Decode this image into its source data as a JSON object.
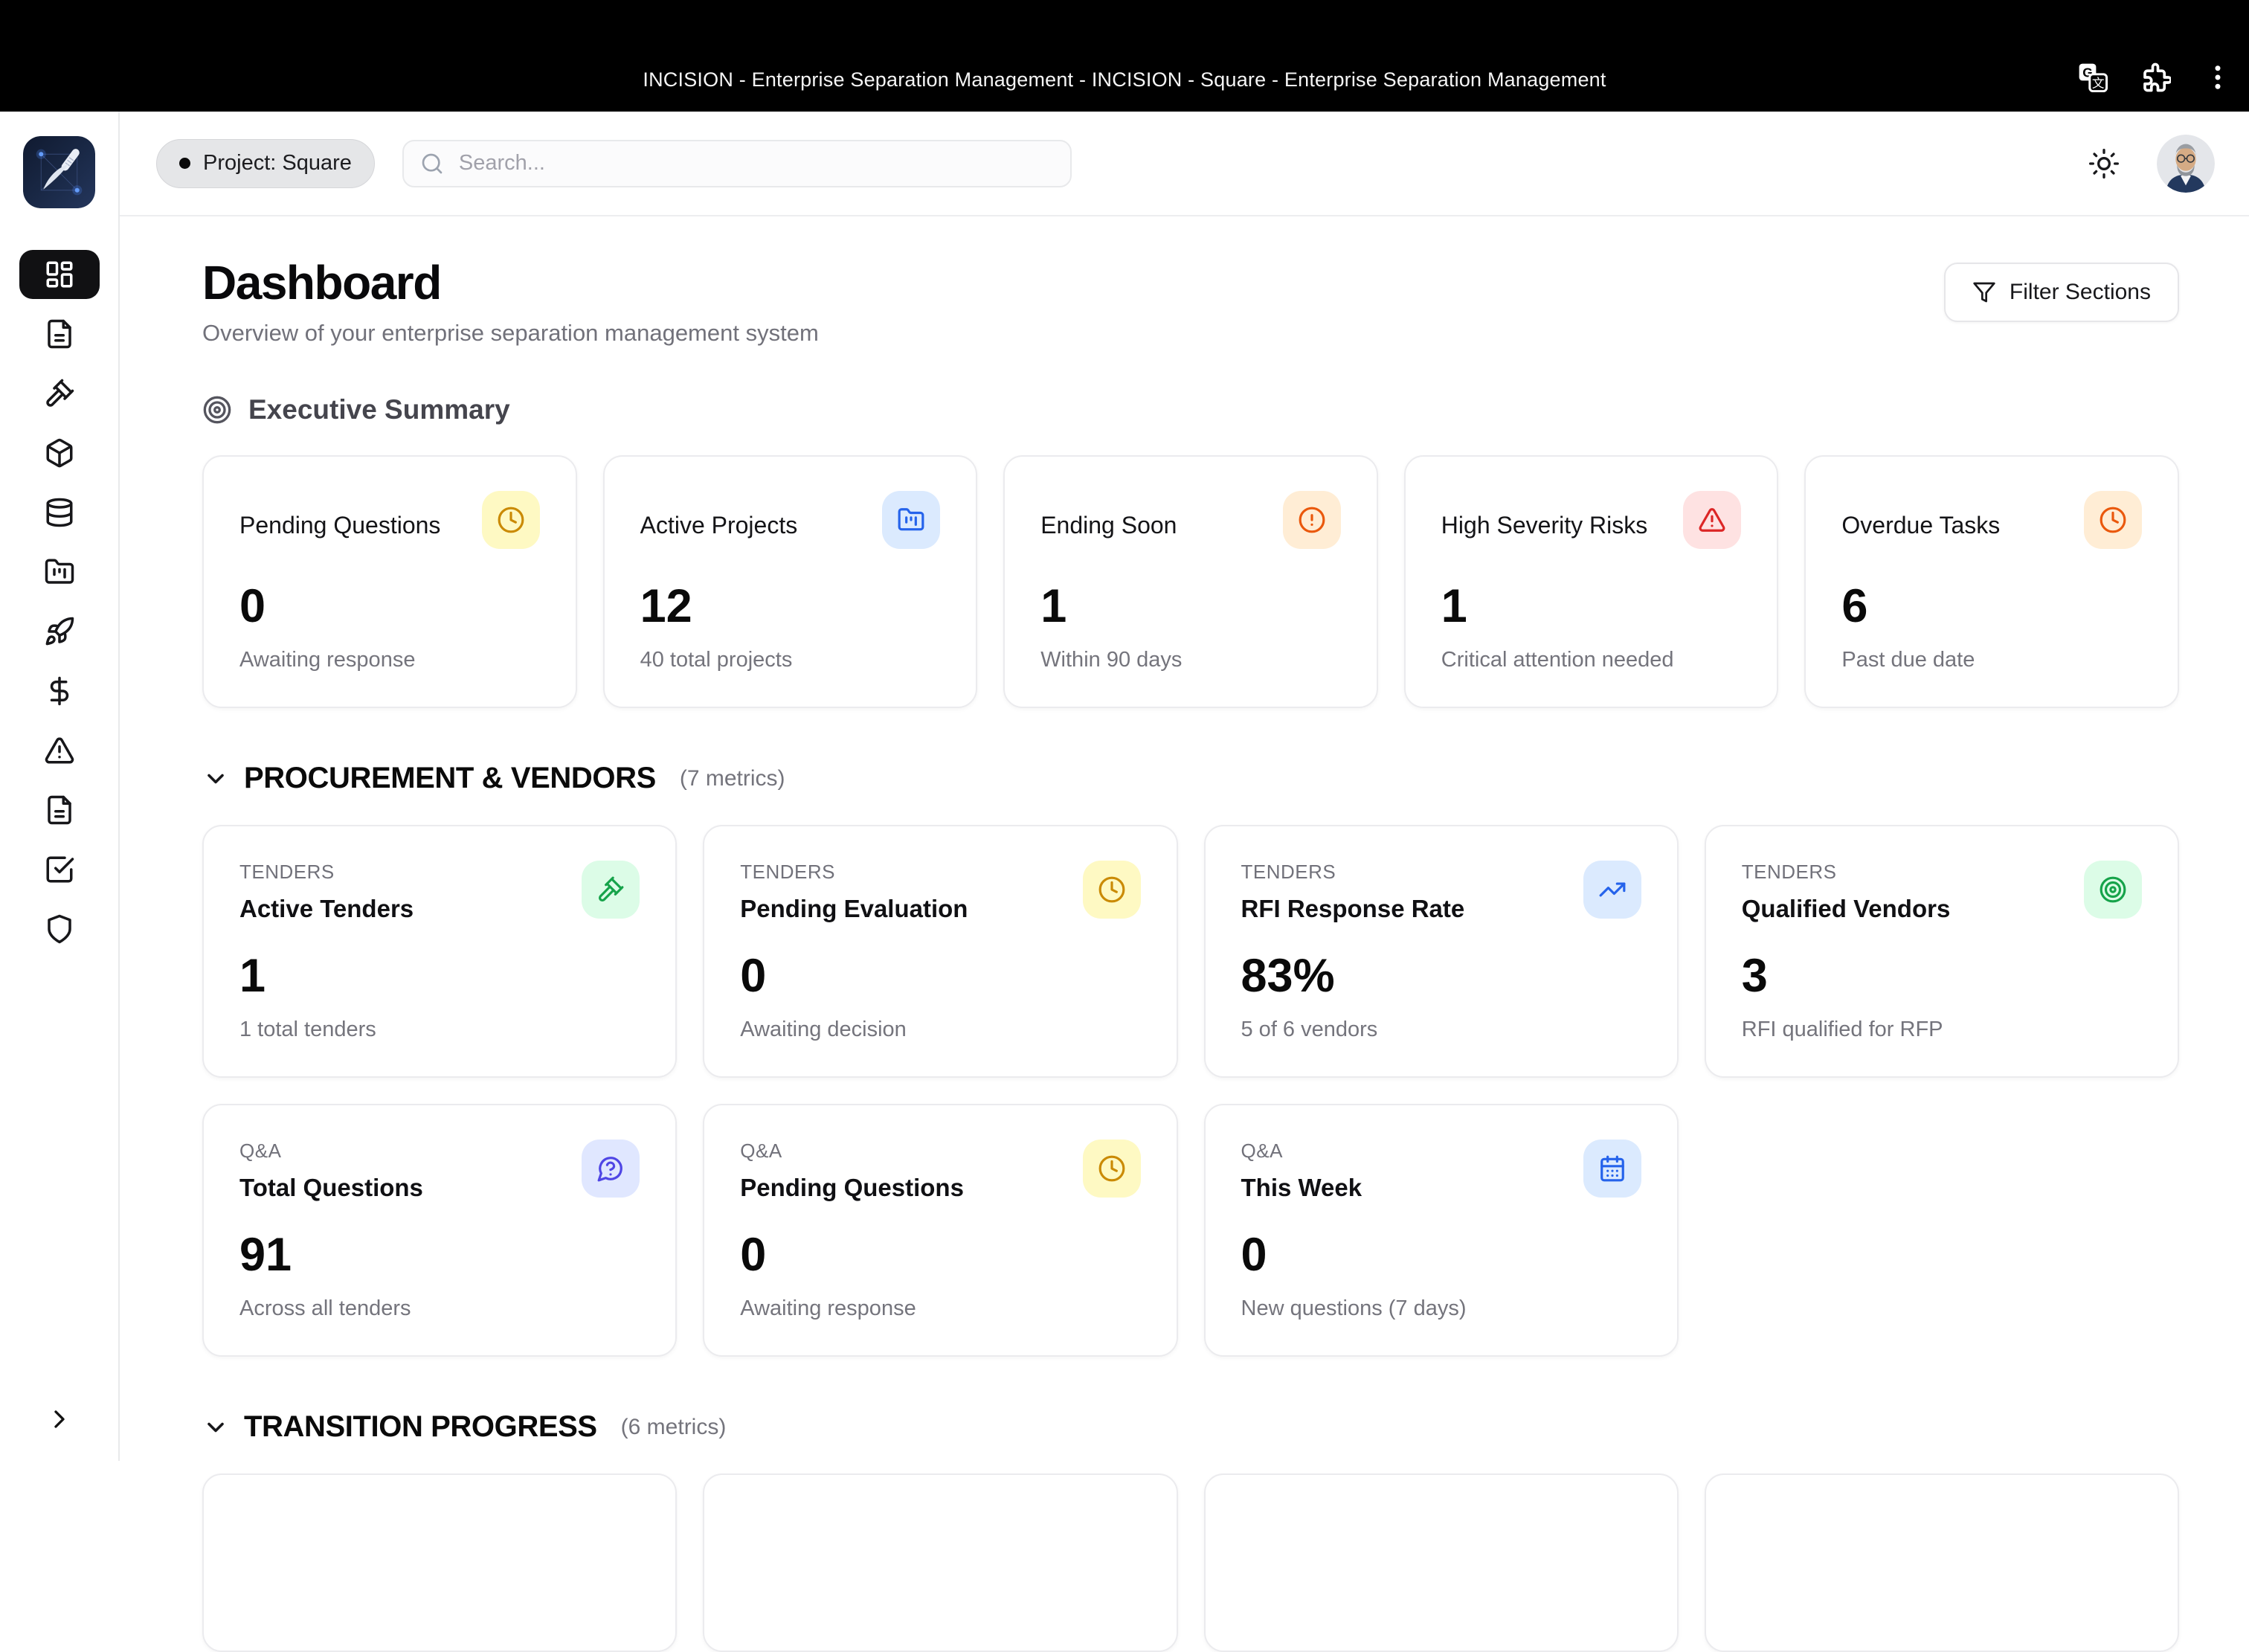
{
  "browser": {
    "title": "INCISION - Enterprise Separation Management - INCISION - Square - Enterprise Separation Management"
  },
  "topbar": {
    "project_chip": "Project: Square",
    "search_placeholder": "Search..."
  },
  "sidebar": {
    "items": [
      {
        "id": "dashboard",
        "icon": "layout-dashboard",
        "active": true
      },
      {
        "id": "documents",
        "icon": "file-text",
        "active": false
      },
      {
        "id": "tenders",
        "icon": "gavel",
        "active": false
      },
      {
        "id": "packages",
        "icon": "package",
        "active": false
      },
      {
        "id": "data",
        "icon": "database",
        "active": false
      },
      {
        "id": "projects",
        "icon": "folder-kanban",
        "active": false
      },
      {
        "id": "launch",
        "icon": "rocket",
        "active": false
      },
      {
        "id": "finance",
        "icon": "dollar-sign",
        "active": false
      },
      {
        "id": "risks",
        "icon": "alert-triangle",
        "active": false
      },
      {
        "id": "reports",
        "icon": "file-text",
        "active": false
      },
      {
        "id": "tasks",
        "icon": "check-square",
        "active": false
      },
      {
        "id": "security",
        "icon": "shield",
        "active": false
      }
    ]
  },
  "page": {
    "title": "Dashboard",
    "subtitle": "Overview of your enterprise separation management system",
    "filter_button": "Filter Sections"
  },
  "palette": {
    "yellow": {
      "bg": "#fef9c3",
      "fg": "#ca8a04"
    },
    "blue": {
      "bg": "#dbeafe",
      "fg": "#2563eb"
    },
    "orange": {
      "bg": "#ffedd5",
      "fg": "#ea580c"
    },
    "red": {
      "bg": "#fee2e2",
      "fg": "#dc2626"
    },
    "green": {
      "bg": "#dcfce7",
      "fg": "#16a34a"
    },
    "indigo": {
      "bg": "#e0e7ff",
      "fg": "#4f46e5"
    }
  },
  "sections": [
    {
      "id": "executive-summary",
      "title": "Executive Summary",
      "cards": [
        {
          "title": "Pending Questions",
          "value": "0",
          "caption": "Awaiting response",
          "icon": "clock",
          "color": "yellow"
        },
        {
          "title": "Active Projects",
          "value": "12",
          "caption": "40 total projects",
          "icon": "folder-kanban",
          "color": "blue"
        },
        {
          "title": "Ending Soon",
          "value": "1",
          "caption": "Within 90 days",
          "icon": "alert-circle",
          "color": "orange"
        },
        {
          "title": "High Severity Risks",
          "value": "1",
          "caption": "Critical attention needed",
          "icon": "alert-triangle",
          "color": "red"
        },
        {
          "title": "Overdue Tasks",
          "value": "6",
          "caption": "Past due date",
          "icon": "clock",
          "color": "orange"
        }
      ]
    },
    {
      "id": "procurement-vendors",
      "title": "PROCUREMENT & VENDORS",
      "note": "(7 metrics)",
      "cards": [
        {
          "group": "TENDERS",
          "title": "Active Tenders",
          "value": "1",
          "caption": "1 total tenders",
          "icon": "gavel",
          "color": "green"
        },
        {
          "group": "TENDERS",
          "title": "Pending Evaluation",
          "value": "0",
          "caption": "Awaiting decision",
          "icon": "clock",
          "color": "yellow"
        },
        {
          "group": "TENDERS",
          "title": "RFI Response Rate",
          "value": "83%",
          "caption": "5 of 6 vendors",
          "icon": "trending-up",
          "color": "blue"
        },
        {
          "group": "TENDERS",
          "title": "Qualified Vendors",
          "value": "3",
          "caption": "RFI qualified for RFP",
          "icon": "target",
          "color": "green"
        },
        {
          "group": "Q&A",
          "title": "Total Questions",
          "value": "91",
          "caption": "Across all tenders",
          "icon": "message-question",
          "color": "indigo"
        },
        {
          "group": "Q&A",
          "title": "Pending Questions",
          "value": "0",
          "caption": "Awaiting response",
          "icon": "clock",
          "color": "yellow"
        },
        {
          "group": "Q&A",
          "title": "This Week",
          "value": "0",
          "caption": "New questions (7 days)",
          "icon": "calendar",
          "color": "blue"
        }
      ]
    },
    {
      "id": "transition-progress",
      "title": "TRANSITION PROGRESS",
      "note": "(6 metrics)",
      "cards": [],
      "visible_stub_cards": 4
    }
  ]
}
